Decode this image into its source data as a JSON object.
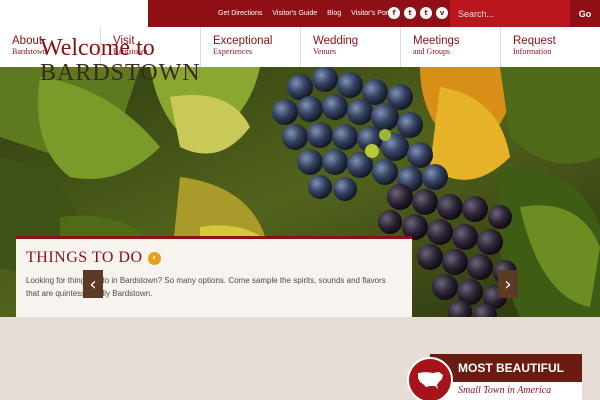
{
  "topbar": {
    "links": [
      "Get Directions",
      "Visitor's Guide",
      "Blog",
      "Visitor's Portal"
    ],
    "social": [
      {
        "icon": "facebook-icon",
        "glyph": "f"
      },
      {
        "icon": "twitter-icon",
        "glyph": "t"
      },
      {
        "icon": "tumblr-icon",
        "glyph": "t"
      },
      {
        "icon": "vimeo-icon",
        "glyph": "v"
      }
    ],
    "search_placeholder": "Search...",
    "go_label": "Go"
  },
  "nav": [
    {
      "main": "About",
      "sub": "Bardstown"
    },
    {
      "main": "Visit",
      "sub": "Bardstown"
    },
    {
      "main": "Exceptional",
      "sub": "Experiences"
    },
    {
      "main": "Wedding",
      "sub": "Venues"
    },
    {
      "main": "Meetings",
      "sub": "and Groups"
    },
    {
      "main": "Request",
      "sub": "Information"
    }
  ],
  "feature": {
    "title": "THINGS TO DO",
    "body": "Looking for things to do in Bardstown? So many options. Come sample the spirits, sounds and flavors that are quintessentially Bardstown."
  },
  "slider": {
    "prev_glyph": "‹",
    "next_glyph": "›"
  },
  "welcome": {
    "line1": "Welcome to",
    "line2": "BARDSTOWN"
  },
  "badge": {
    "top": "MOST BEAUTIFUL",
    "bottom": "Small Town in America"
  },
  "colors": {
    "brand_red": "#8e0f15",
    "accent_orange": "#e6a11a"
  }
}
